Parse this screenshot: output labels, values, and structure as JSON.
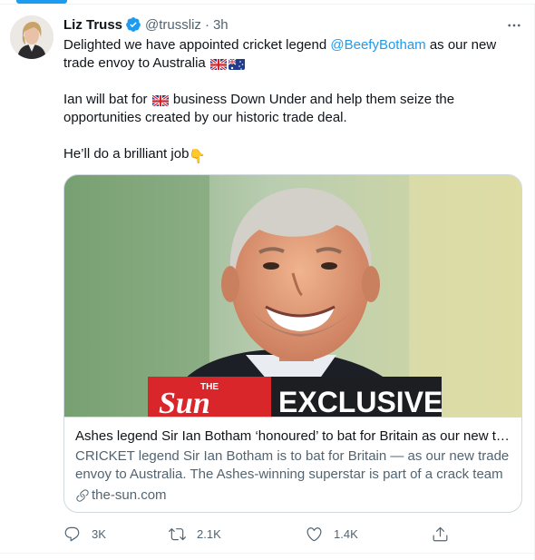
{
  "tweet": {
    "author": {
      "name": "Liz Truss",
      "handle": "@trussliz",
      "separator": "·",
      "time": "3h",
      "verified": true
    },
    "more_icon": "more-horizontal-icon",
    "text": {
      "line1_prefix": "Delighted we have appointed cricket legend ",
      "mention": "@BeefyBotham",
      "line1_suffix": " as our new trade envoy to Australia ",
      "para2_prefix": "Ian will bat for ",
      "para2_suffix": " business Down Under and help them seize the opportunities created by our historic trade deal.",
      "para3": "He’ll do a brilliant job",
      "hand_emoji": "👇"
    },
    "card": {
      "image_banner_small": "THE",
      "image_banner_brand": "Sun",
      "image_banner_tag": "EXCLUSIVE",
      "title": "Ashes legend Sir Ian Botham ‘honoured’ to bat for Britain as our new trade envoy to Australia",
      "description": "CRICKET legend Sir Ian Botham is to bat for Britain — as our new trade envoy to Australia. The Ashes-winning superstar is part of a crack team",
      "domain": "the-sun.com"
    },
    "actions": {
      "replies": "3K",
      "retweets": "2.1K",
      "likes": "1.4K"
    },
    "colors": {
      "accent": "#1d9bf0",
      "text": "#0f1419",
      "muted": "#536471",
      "border": "#cfd9de",
      "sun_red": "#d9262b"
    }
  }
}
